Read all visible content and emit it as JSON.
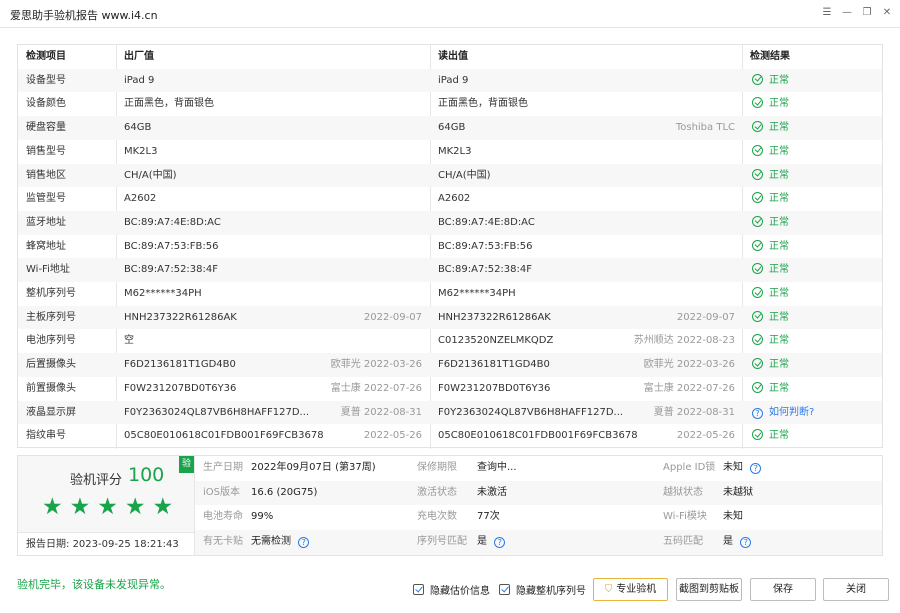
{
  "window": {
    "title": "爱思助手验机报告 www.i4.cn",
    "controls": [
      "menu-icon",
      "minimize-icon",
      "restore-icon",
      "close-icon"
    ]
  },
  "table": {
    "headers": {
      "item": "检测项目",
      "factory": "出厂值",
      "read": "读出值",
      "result": "检测结果"
    },
    "rows": [
      {
        "item": "设备型号",
        "factory": "iPad 9",
        "factory_sub": "",
        "read": "iPad 9",
        "read_sub": "",
        "result": "正常",
        "status": "ok"
      },
      {
        "item": "设备颜色",
        "factory": "正面黑色，背面银色",
        "factory_sub": "",
        "read": "正面黑色，背面银色",
        "read_sub": "",
        "result": "正常",
        "status": "ok"
      },
      {
        "item": "硬盘容量",
        "factory": "64GB",
        "factory_sub": "",
        "read": "64GB",
        "read_sub": "Toshiba TLC",
        "result": "正常",
        "status": "ok"
      },
      {
        "item": "销售型号",
        "factory": "MK2L3",
        "factory_sub": "",
        "read": "MK2L3",
        "read_sub": "",
        "result": "正常",
        "status": "ok"
      },
      {
        "item": "销售地区",
        "factory": "CH/A(中国)",
        "factory_sub": "",
        "read": "CH/A(中国)",
        "read_sub": "",
        "result": "正常",
        "status": "ok"
      },
      {
        "item": "监管型号",
        "factory": "A2602",
        "factory_sub": "",
        "read": "A2602",
        "read_sub": "",
        "result": "正常",
        "status": "ok"
      },
      {
        "item": "蓝牙地址",
        "factory": "BC:89:A7:4E:8D:AC",
        "factory_sub": "",
        "read": "BC:89:A7:4E:8D:AC",
        "read_sub": "",
        "result": "正常",
        "status": "ok"
      },
      {
        "item": "蜂窝地址",
        "factory": "BC:89:A7:53:FB:56",
        "factory_sub": "",
        "read": "BC:89:A7:53:FB:56",
        "read_sub": "",
        "result": "正常",
        "status": "ok"
      },
      {
        "item": "Wi-Fi地址",
        "factory": "BC:89:A7:52:38:4F",
        "factory_sub": "",
        "read": "BC:89:A7:52:38:4F",
        "read_sub": "",
        "result": "正常",
        "status": "ok"
      },
      {
        "item": "整机序列号",
        "factory": "M62******34PH",
        "factory_sub": "",
        "read": "M62******34PH",
        "read_sub": "",
        "result": "正常",
        "status": "ok"
      },
      {
        "item": "主板序列号",
        "factory": "HNH237322R61286AK",
        "factory_sub": "2022-09-07",
        "read": "HNH237322R61286AK",
        "read_sub": "2022-09-07",
        "result": "正常",
        "status": "ok"
      },
      {
        "item": "电池序列号",
        "factory": "空",
        "factory_sub": "",
        "read": "C0123520NZELMKQDZ",
        "read_sub": "苏州顺达 2022-08-23",
        "result": "正常",
        "status": "ok"
      },
      {
        "item": "后置摄像头",
        "factory": "F6D2136181T1GD4B0",
        "factory_sub": "欧菲光 2022-03-26",
        "read": "F6D2136181T1GD4B0",
        "read_sub": "欧菲光 2022-03-26",
        "result": "正常",
        "status": "ok"
      },
      {
        "item": "前置摄像头",
        "factory": "F0W231207BD0T6Y36",
        "factory_sub": "富士康 2022-07-26",
        "read": "F0W231207BD0T6Y36",
        "read_sub": "富士康 2022-07-26",
        "result": "正常",
        "status": "ok"
      },
      {
        "item": "液晶显示屏",
        "factory": "F0Y2363024QL87VB6H8HAFF127D...",
        "factory_sub": "夏普 2022-08-31",
        "read": "F0Y2363024QL87VB6H8HAFF127D...",
        "read_sub": "夏普 2022-08-31",
        "result": "如何判断?",
        "status": "question"
      },
      {
        "item": "指纹串号",
        "factory": "05C80E010618C01FDB001F69FCB3678F",
        "factory_sub": "2022-05-26",
        "read": "05C80E010618C01FDB001F69FCB3678F",
        "read_sub": "2022-05-26",
        "result": "正常",
        "status": "ok"
      }
    ]
  },
  "summary": {
    "score_label": "验机评分",
    "score": "100",
    "stars": "★★★★★",
    "badge": "验",
    "report_date_label": "报告日期:",
    "report_date": "2023-09-25 18:21:43",
    "rows": [
      [
        {
          "k": "生产日期",
          "v": "2022年09月07日 (第37周)"
        },
        {
          "k": "保修期限",
          "v": "查询中..."
        },
        {
          "k": "Apple ID锁",
          "v": "未知",
          "help": true
        }
      ],
      [
        {
          "k": "iOS版本",
          "v": "16.6 (20G75)"
        },
        {
          "k": "激活状态",
          "v": "未激活"
        },
        {
          "k": "越狱状态",
          "v": "未越狱"
        }
      ],
      [
        {
          "k": "电池寿命",
          "v": "99%"
        },
        {
          "k": "充电次数",
          "v": "77次"
        },
        {
          "k": "Wi-Fi模块",
          "v": "未知"
        }
      ],
      [
        {
          "k": "有无卡贴",
          "v": "无需检测",
          "help": true
        },
        {
          "k": "序列号匹配",
          "v": "是",
          "help": true,
          "green": true
        },
        {
          "k": "五码匹配",
          "v": "是",
          "help": true,
          "green": true
        }
      ]
    ]
  },
  "footer": {
    "message": "验机完毕，该设备未发现异常。",
    "hide_price_label": "隐藏估价信息",
    "hide_serial_label": "隐藏整机序列号",
    "pro_button": "专业验机",
    "screenshot_button": "截图到剪贴板",
    "save_button": "保存",
    "close_button": "关闭"
  },
  "colors": {
    "ok_green": "#19a34a",
    "link_blue": "#2c7be5"
  }
}
